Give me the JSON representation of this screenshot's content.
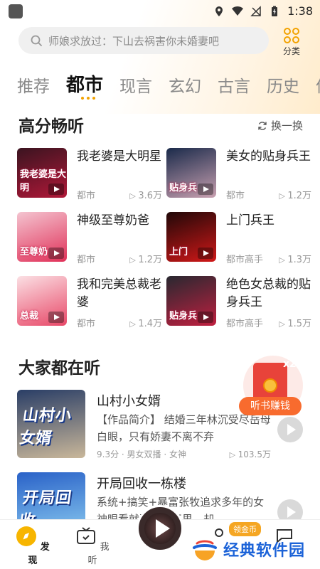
{
  "status_bar": {
    "time": "1:38"
  },
  "search": {
    "placeholder": "师娘求放过：下山去祸害你未婚妻吧"
  },
  "category_button": {
    "label": "分类"
  },
  "tabs": [
    {
      "label": "推荐"
    },
    {
      "label": "都市",
      "active": true
    },
    {
      "label": "现言"
    },
    {
      "label": "玄幻"
    },
    {
      "label": "古言"
    },
    {
      "label": "历史"
    },
    {
      "label": "仙"
    }
  ],
  "high_score": {
    "title": "高分畅听",
    "refresh_label": "换一换",
    "items": [
      {
        "title": "我老婆是大明星",
        "tag": "都市",
        "plays": "3.6万",
        "cover_text": "我老婆是大明",
        "cover_colors": [
          "#3a1420",
          "#b01838"
        ]
      },
      {
        "title": "美女的贴身兵王",
        "tag": "都市",
        "plays": "1.2万",
        "cover_text": "贴身兵",
        "cover_colors": [
          "#1a2a4a",
          "#c8a0b0"
        ]
      },
      {
        "title": "神级至尊奶爸",
        "tag": "都市",
        "plays": "1.2万",
        "cover_text": "至尊奶",
        "cover_colors": [
          "#f4c4d0",
          "#e03058"
        ]
      },
      {
        "title": "上门兵王",
        "tag": "都市高手",
        "plays": "1.3万",
        "cover_text": "上门",
        "cover_colors": [
          "#200808",
          "#d01818"
        ]
      },
      {
        "title": "我和完美总裁老婆",
        "tag": "都市",
        "plays": "1.4万",
        "cover_text": "总裁",
        "cover_colors": [
          "#fbe0e4",
          "#e84868"
        ]
      },
      {
        "title": "绝色女总裁的贴身兵王",
        "tag": "都市高手",
        "plays": "1.5万",
        "cover_text": "贴身兵",
        "cover_colors": [
          "#282830",
          "#c02040"
        ]
      }
    ]
  },
  "everyone": {
    "title": "大家都在听",
    "items": [
      {
        "title": "山村小女婿",
        "description": "【作品简介】    结婚三年林沉受尽岳母白眼，只有娇妻不离不弃",
        "score": "9.3分 · 男女双播 · 女神",
        "plays": "103.5万",
        "cover_text": "山村小女婿",
        "cover_colors": [
          "#2a3e66",
          "#c9b79a"
        ]
      },
      {
        "title": "开局回收一栋楼",
        "description": "系统+搞笑+暴富张牧追求多年的女神眼看就要修成正果，却",
        "score": "",
        "plays": "",
        "cover_text": "开局回收",
        "cover_colors": [
          "#2a62c8",
          "#8fd0f2"
        ]
      }
    ]
  },
  "float_promo": {
    "label": "听书赚钱",
    "multiplier": "x2"
  },
  "bottom_nav": {
    "items": [
      {
        "label": "发现",
        "active": true
      },
      {
        "label": "我听"
      }
    ],
    "gold_badge": "领金币"
  },
  "watermark": {
    "text": "经典软件园"
  },
  "colors": {
    "accent": "#f2a200",
    "promo": "#f86b2e",
    "watermark": "#1c63d8"
  }
}
